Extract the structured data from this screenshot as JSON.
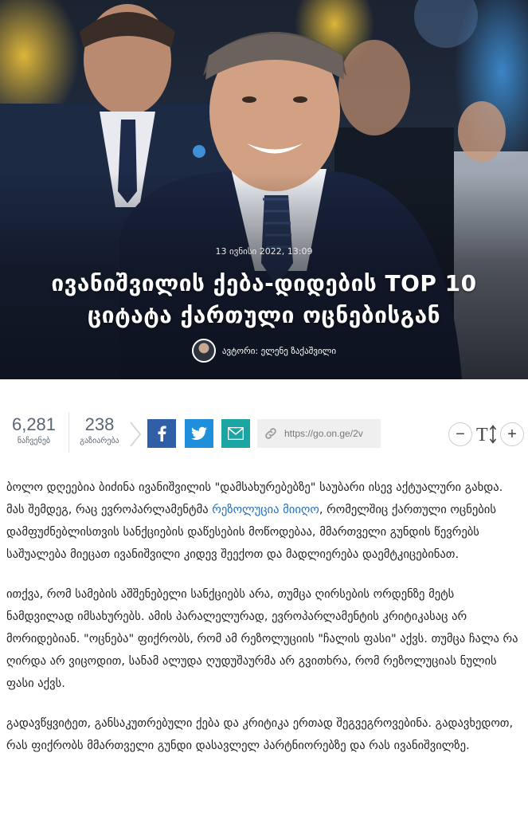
{
  "hero": {
    "date": "13 ივნისი 2022, 13:09",
    "title": "ივანიშვილის ქება-დიდების TOP 10 ციტატა ქართული ოცნებისგან",
    "author": "ავტორი: ელენე ზაქაშვილი"
  },
  "stats": {
    "views_value": "6,281",
    "views_label": "ნაჩვენებ",
    "shares_value": "238",
    "shares_label": "გაზიარება"
  },
  "share": {
    "url": "https://go.on.ge/2v",
    "facebook_color": "#2f5fa7",
    "twitter_color": "#1f8fdc",
    "mail_color": "#1aa5a3"
  },
  "font_controls": {
    "minus": "−",
    "plus": "+"
  },
  "article": {
    "p1_a": "ბოლო დღეებია ბიძინა ივანიშვილის \"დამსახურებებზე\" საუბარი ისევ აქტუალური გახდა. მას შემდეგ, რაც ევროპარლამენტმა ",
    "p1_link": "რეზოლუცია მიიღო",
    "p1_b": ", რომელშიც ქართული ოცნების დამფუძნებლისთვის სანქციების დაწესების მოწოდებაა, მმართველი გუნდის წევრებს საშუალება მიეცათ ივანიშვილი კიდევ შეექოთ და მადლიერება დაემტკიცებინათ.",
    "p2": "ითქვა, რომ სამების აშშენებელი სანქციებს არა, თუმცა ღირსების ორდენზე მეტს ნამდვილად იმსახურებს. ამის პარალელურად, ევროპარლამენტის კრიტიკასაც არ მორიდებიან. \"ოცნება\" ფიქრობს, რომ ამ რეზოლუციის \"ჩალის ფასი\" აქვს. თუმცა ჩალა რა ღირდა არ ვიცოდით, სანამ ალუდა ღუდუშაურმა არ გვითხრა, რომ რეზოლუციას ნულის ფასი აქვს.",
    "p3": "გადავწყვიტეთ, განსაკუთრებული ქება და კრიტიკა ერთად შეგვეგროვებინა. გადავხედოთ, რას ფიქრობს მმართველი გუნდი დასავლელ პარტნიორებზე და რას ივანიშვილზე."
  }
}
